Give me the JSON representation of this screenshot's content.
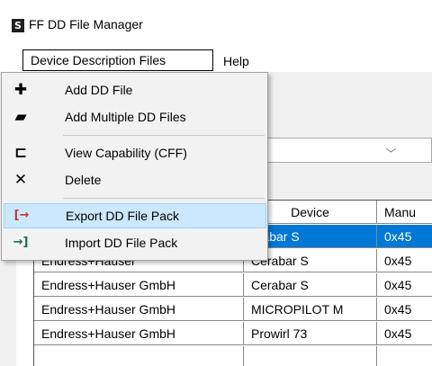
{
  "window": {
    "title": "FF DD File Manager",
    "icon_letter": "S"
  },
  "menubar": {
    "device_files": "Device Description Files",
    "help": "Help"
  },
  "menu": {
    "items": [
      {
        "label": "Add DD File",
        "icon": "plus-icon",
        "glyph": "✚"
      },
      {
        "label": "Add Multiple DD Files",
        "icon": "folder-icon",
        "glyph": "▰"
      },
      {
        "label": "View Capability (CFF)",
        "icon": "capability-icon",
        "glyph": "⊏"
      },
      {
        "label": "Delete",
        "icon": "delete-x-icon",
        "glyph": "✕"
      },
      {
        "label": "Export DD File Pack",
        "icon": "export-icon",
        "glyph": "[→"
      },
      {
        "label": "Import DD File Pack",
        "icon": "import-icon",
        "glyph": "→]"
      }
    ]
  },
  "table": {
    "headers": [
      "Device",
      "Manu"
    ],
    "rows": [
      {
        "company": "",
        "device": "erabar S",
        "manu": "0x45",
        "selected": true
      },
      {
        "company": "Endress+Hauser",
        "device": "Cerabar S",
        "manu": "0x45"
      },
      {
        "company": "Endress+Hauser GmbH",
        "device": "Cerabar S",
        "manu": "0x45"
      },
      {
        "company": "Endress+Hauser GmbH",
        "device": "MICROPILOT M",
        "manu": "0x45"
      },
      {
        "company": "Endress+Hauser GmbH",
        "device": "Prowirl 73",
        "manu": "0x45"
      }
    ]
  },
  "colors": {
    "selection": "#0078d7",
    "highlight": "#cce8ff",
    "export_icon": "#c0392b",
    "import_icon": "#1f6f3a"
  }
}
